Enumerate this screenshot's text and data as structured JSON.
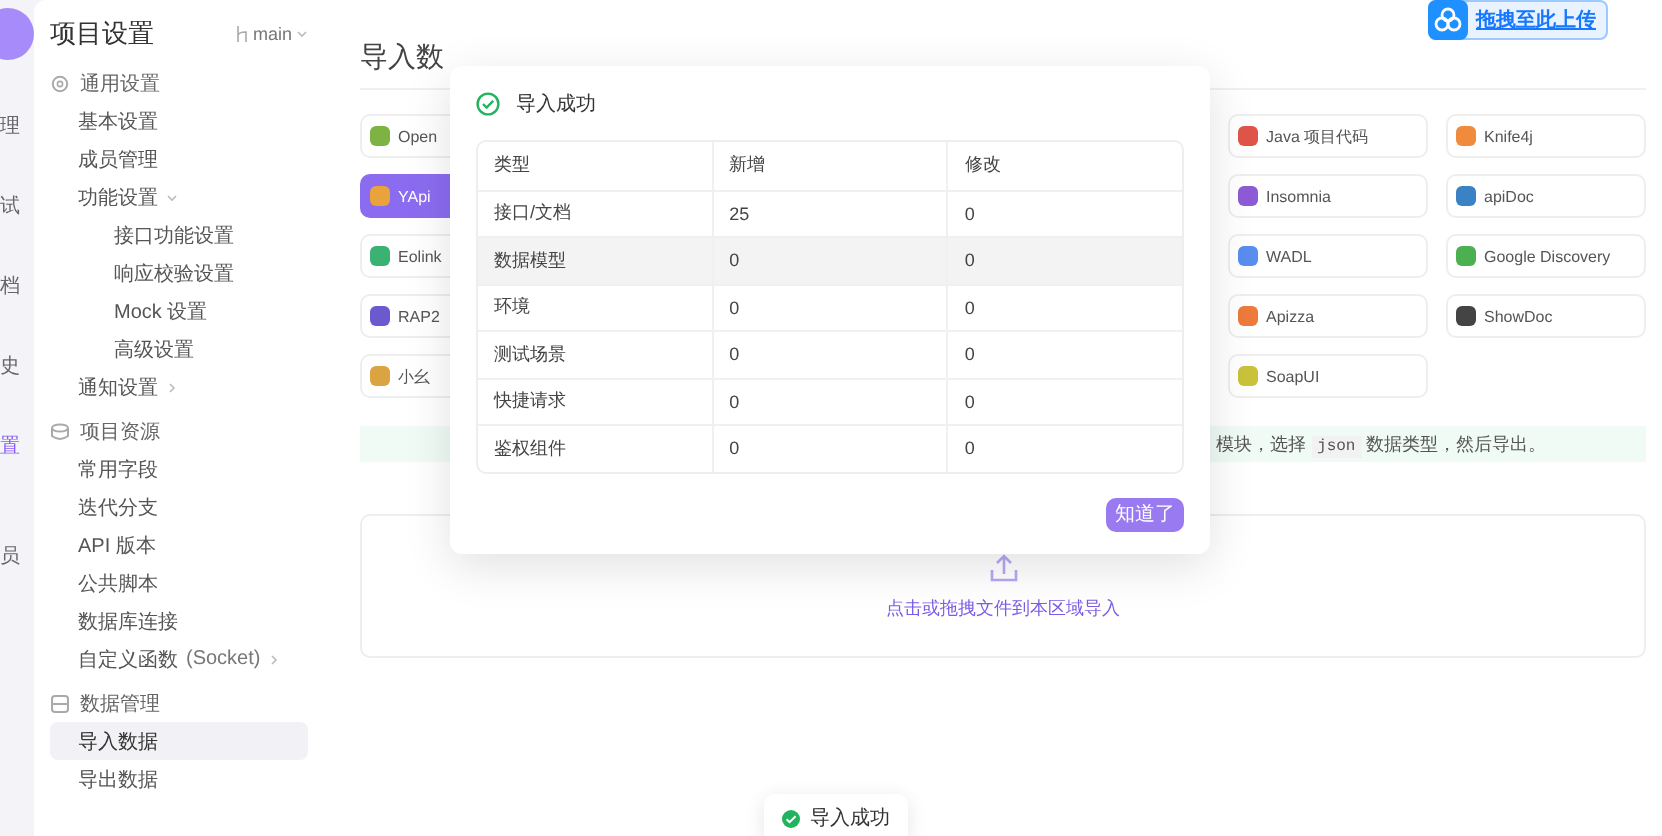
{
  "rail": {
    "items": [
      {
        "label": "理",
        "selected": false
      },
      {
        "label": "试",
        "selected": false
      },
      {
        "label": "档",
        "selected": false
      },
      {
        "label": "史",
        "selected": false
      },
      {
        "label": "置",
        "selected": true
      },
      {
        "label": "员",
        "selected": false
      }
    ]
  },
  "sidebar": {
    "title": "项目设置",
    "branch": "main",
    "groups": [
      {
        "label": "通用设置",
        "items": [
          {
            "label": "基本设置",
            "selected": false
          },
          {
            "label": "成员管理",
            "selected": false
          },
          {
            "label": "功能设置",
            "selected": false,
            "expanded": true,
            "children": [
              {
                "label": "接口功能设置",
                "selected": false
              },
              {
                "label": "响应校验设置",
                "selected": false
              },
              {
                "label": "Mock 设置",
                "selected": false
              },
              {
                "label": "高级设置",
                "selected": false
              }
            ]
          },
          {
            "label": "通知设置",
            "selected": false,
            "expanded": false
          }
        ]
      },
      {
        "label": "项目资源",
        "items": [
          {
            "label": "常用字段",
            "selected": false
          },
          {
            "label": "迭代分支",
            "selected": false
          },
          {
            "label": "API 版本",
            "selected": false
          },
          {
            "label": "公共脚本",
            "selected": false
          },
          {
            "label": "数据库连接",
            "selected": false
          },
          {
            "label": "自定义函数",
            "note": "(Socket)",
            "selected": false,
            "expanded": false
          }
        ]
      },
      {
        "label": "数据管理",
        "items": [
          {
            "label": "导入数据",
            "selected": true
          },
          {
            "label": "导出数据",
            "selected": false
          }
        ]
      }
    ]
  },
  "main": {
    "title": "导入数",
    "source_columns": [
      {
        "items": [
          {
            "label": "Open",
            "selected": false,
            "color": "#7cb342"
          },
          {
            "label": "YApi",
            "selected": true,
            "color": "#e8a33d"
          },
          {
            "label": "Eolink",
            "selected": false,
            "color": "#3bb273"
          },
          {
            "label": "RAP2",
            "selected": false,
            "color": "#6a5acd"
          },
          {
            "label": "小幺",
            "selected": false,
            "color": "#d9a441"
          }
        ]
      },
      {
        "items": [
          {
            "label": "Java 项目代码",
            "selected": false,
            "color": "#e0554a"
          },
          {
            "label": "Insomnia",
            "selected": false,
            "color": "#8e5bd6"
          },
          {
            "label": "WADL",
            "selected": false,
            "color": "#5a8df0"
          },
          {
            "label": "Apizza",
            "selected": false,
            "color": "#ee7a3b"
          },
          {
            "label": "SoapUI",
            "selected": false,
            "color": "#c9c23a"
          }
        ]
      },
      {
        "items": [
          {
            "label": "Knife4j",
            "selected": false,
            "color": "#f08a3c"
          },
          {
            "label": "apiDoc",
            "selected": false,
            "color": "#3b82c4"
          },
          {
            "label": "Google Discovery",
            "selected": false,
            "color": "#4caf50"
          },
          {
            "label": "ShowDoc",
            "selected": false,
            "color": "#444444"
          }
        ]
      }
    ],
    "hint": {
      "before": "模块，选择",
      "code": "json",
      "after": "数据类型，然后导出。"
    },
    "upload": {
      "text": "点击或拖拽文件到本区域导入"
    }
  },
  "dialog": {
    "title": "导入成功",
    "columns": [
      "类型",
      "新增",
      "修改"
    ],
    "rows": [
      {
        "cells": [
          "接口/文档",
          "25",
          "0"
        ],
        "highlighted": false
      },
      {
        "cells": [
          "数据模型",
          "0",
          "0"
        ],
        "highlighted": true
      },
      {
        "cells": [
          "环境",
          "0",
          "0"
        ],
        "highlighted": false
      },
      {
        "cells": [
          "测试场景",
          "0",
          "0"
        ],
        "highlighted": false
      },
      {
        "cells": [
          "快捷请求",
          "0",
          "0"
        ],
        "highlighted": false
      },
      {
        "cells": [
          "鉴权组件",
          "0",
          "0"
        ],
        "highlighted": false
      }
    ],
    "button": "知道了"
  },
  "toast": {
    "text": "导入成功"
  },
  "upload_badge": {
    "text": "拖拽至此上传"
  }
}
